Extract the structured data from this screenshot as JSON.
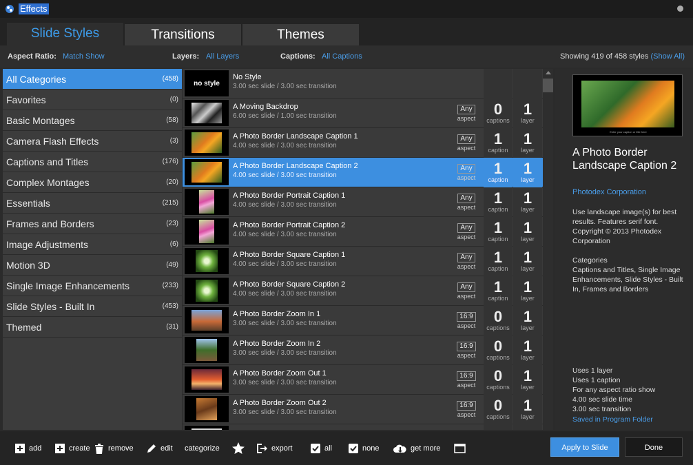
{
  "window": {
    "title": "Effects"
  },
  "tabs": [
    {
      "label": "Slide Styles",
      "active": true
    },
    {
      "label": "Transitions",
      "active": false
    },
    {
      "label": "Themes",
      "active": false
    }
  ],
  "filters": {
    "aspect_label": "Aspect Ratio:",
    "aspect_value": "Match Show",
    "layers_label": "Layers:",
    "layers_value": "All Layers",
    "captions_label": "Captions:",
    "captions_value": "All Captions",
    "showing": "Showing 419 of 458 styles",
    "show_all": "(Show All)"
  },
  "categories": [
    {
      "name": "All Categories",
      "count": "(458)",
      "selected": true
    },
    {
      "name": "Favorites",
      "count": "(0)"
    },
    {
      "name": "Basic Montages",
      "count": "(58)"
    },
    {
      "name": "Camera Flash Effects",
      "count": "(3)"
    },
    {
      "name": "Captions and Titles",
      "count": "(176)"
    },
    {
      "name": "Complex Montages",
      "count": "(20)"
    },
    {
      "name": "Essentials",
      "count": "(215)"
    },
    {
      "name": "Frames and Borders",
      "count": "(23)"
    },
    {
      "name": "Image Adjustments",
      "count": "(6)"
    },
    {
      "name": "Motion 3D",
      "count": "(49)"
    },
    {
      "name": "Single Image Enhancements",
      "count": "(233)"
    },
    {
      "name": "Slide Styles - Built In",
      "count": "(453)"
    },
    {
      "name": "Themed",
      "count": "(31)"
    }
  ],
  "styles": [
    {
      "name": "No Style",
      "desc": "3.00 sec slide / 3.00 sec transition",
      "thumb_text": "no style",
      "aspect": "",
      "aspect_label": "",
      "captions": "",
      "captions_label": "",
      "layers": "",
      "layers_label": ""
    },
    {
      "name": "A Moving Backdrop",
      "desc": "6.00 sec slide / 1.00 sec transition",
      "thumb": "butterfly-bw",
      "aspect": "Any",
      "aspect_label": "aspect",
      "captions": "0",
      "captions_label": "captions",
      "layers": "1",
      "layers_label": "layer"
    },
    {
      "name": "A Photo Border Landscape Caption 1",
      "desc": "4.00 sec slide / 3.00 sec transition",
      "thumb": "butterfly",
      "aspect": "Any",
      "aspect_label": "aspect",
      "captions": "1",
      "captions_label": "caption",
      "layers": "1",
      "layers_label": "layer"
    },
    {
      "name": "A Photo Border Landscape Caption 2",
      "desc": "4.00 sec slide / 3.00 sec transition",
      "thumb": "butterfly",
      "aspect": "Any",
      "aspect_label": "aspect",
      "captions": "1",
      "captions_label": "caption",
      "layers": "1",
      "layers_label": "layer",
      "selected": true
    },
    {
      "name": "A Photo Border Portrait Caption 1",
      "desc": "4.00 sec slide / 3.00 sec transition",
      "thumb": "flower-portrait",
      "aspect": "Any",
      "aspect_label": "aspect",
      "captions": "1",
      "captions_label": "caption",
      "layers": "1",
      "layers_label": "layer"
    },
    {
      "name": "A Photo Border Portrait Caption 2",
      "desc": "4.00 sec slide / 3.00 sec transition",
      "thumb": "flower-portrait",
      "aspect": "Any",
      "aspect_label": "aspect",
      "captions": "1",
      "captions_label": "caption",
      "layers": "1",
      "layers_label": "layer"
    },
    {
      "name": "A Photo Border Square Caption 1",
      "desc": "4.00 sec slide / 3.00 sec transition",
      "thumb": "leaf-square",
      "aspect": "Any",
      "aspect_label": "aspect",
      "captions": "1",
      "captions_label": "caption",
      "layers": "1",
      "layers_label": "layer"
    },
    {
      "name": "A Photo Border Square Caption 2",
      "desc": "4.00 sec slide / 3.00 sec transition",
      "thumb": "leaf-square",
      "aspect": "Any",
      "aspect_label": "aspect",
      "captions": "1",
      "captions_label": "caption",
      "layers": "1",
      "layers_label": "layer"
    },
    {
      "name": "A Photo Border Zoom In 1",
      "desc": "3.00 sec slide / 3.00 sec transition",
      "thumb": "city",
      "aspect": "16:9",
      "aspect_label": "aspect",
      "captions": "0",
      "captions_label": "captions",
      "layers": "1",
      "layers_label": "layer"
    },
    {
      "name": "A Photo Border Zoom In 2",
      "desc": "3.00 sec slide / 3.00 sec transition",
      "thumb": "valley",
      "aspect": "16:9",
      "aspect_label": "aspect",
      "captions": "0",
      "captions_label": "captions",
      "layers": "1",
      "layers_label": "layer"
    },
    {
      "name": "A Photo Border Zoom Out 1",
      "desc": "3.00 sec slide / 3.00 sec transition",
      "thumb": "sunset",
      "aspect": "16:9",
      "aspect_label": "aspect",
      "captions": "0",
      "captions_label": "captions",
      "layers": "1",
      "layers_label": "layer"
    },
    {
      "name": "A Photo Border Zoom Out 2",
      "desc": "3.00 sec slide / 3.00 sec transition",
      "thumb": "canyon",
      "aspect": "16:9",
      "aspect_label": "aspect",
      "captions": "0",
      "captions_label": "captions",
      "layers": "1",
      "layers_label": "layer"
    },
    {
      "name": "",
      "desc": "",
      "thumb": "partial",
      "aspect": "",
      "aspect_label": "",
      "captions": "",
      "captions_label": "",
      "layers": "",
      "layers_label": ""
    }
  ],
  "detail": {
    "preview_caption": "Enter your caption or title here",
    "title": "A Photo Border Landscape Caption 2",
    "author": "Photodex Corporation",
    "description": "Use landscape image(s) for best results. Features serif font. Copyright © 2013 Photodex Corporation",
    "categories_heading": "Categories",
    "categories_text": "Captions and Titles, Single Image Enhancements, Slide Styles - Built In, Frames and Borders",
    "uses_layer": "Uses 1 layer",
    "uses_caption": "Uses 1 caption",
    "aspect_info": "For any aspect ratio show",
    "slide_time": "4.00 sec slide time",
    "transition_time": "3.00 sec transition",
    "saved": "Saved in Program Folder"
  },
  "toolbar": {
    "add": "add",
    "create": "create",
    "remove": "remove",
    "edit": "edit",
    "categorize": "categorize",
    "export": "export",
    "all": "all",
    "none": "none",
    "get_more": "get more",
    "apply": "Apply to Slide",
    "done": "Done"
  },
  "colors": {
    "accent": "#3d8fe0",
    "link": "#4a9de8"
  }
}
